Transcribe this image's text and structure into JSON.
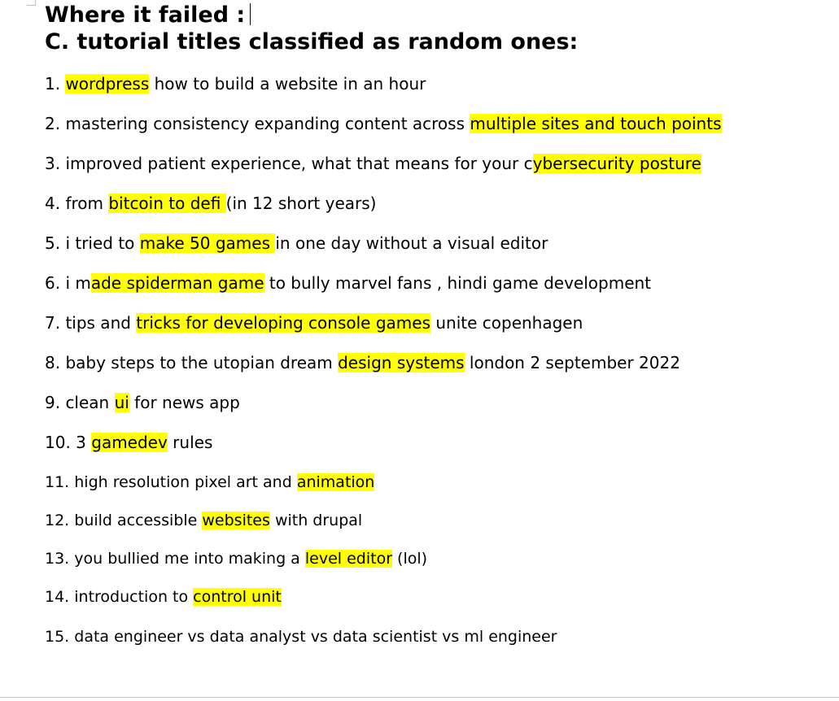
{
  "document": {
    "heading_line1": "Where it failed :",
    "heading_line2": "C. tutorial titles classified as random ones:",
    "highlight_color": "#ffff00",
    "items": [
      {
        "parts": [
          {
            "t": "1. ",
            "h": false
          },
          {
            "t": "wordpress",
            "h": true
          },
          {
            "t": " how to build a website in an hour",
            "h": false
          }
        ]
      },
      {
        "parts": [
          {
            "t": "2. mastering consistency expanding content across ",
            "h": false
          },
          {
            "t": "multiple sites and touch points",
            "h": true
          }
        ]
      },
      {
        "parts": [
          {
            "t": "3. improved patient experience, what that means for your c",
            "h": false
          },
          {
            "t": "ybersecurity posture",
            "h": true
          }
        ]
      },
      {
        "parts": [
          {
            "t": "4. from ",
            "h": false
          },
          {
            "t": "bitcoin to defi ",
            "h": true
          },
          {
            "t": "(in 12 short years)",
            "h": false
          }
        ]
      },
      {
        "parts": [
          {
            "t": "5.  i tried to ",
            "h": false
          },
          {
            "t": "make 50 games ",
            "h": true
          },
          {
            "t": "in one day without a visual editor",
            "h": false
          }
        ]
      },
      {
        "parts": [
          {
            "t": "6. i m",
            "h": false
          },
          {
            "t": "ade spiderman game",
            "h": true
          },
          {
            "t": " to bully marvel fans , hindi game development",
            "h": false
          }
        ]
      },
      {
        "parts": [
          {
            "t": "7.  tips and ",
            "h": false
          },
          {
            "t": "tricks for developing console games",
            "h": true
          },
          {
            "t": " unite copenhagen",
            "h": false
          }
        ]
      },
      {
        "parts": [
          {
            "t": "8. baby steps to the utopian dream ",
            "h": false
          },
          {
            "t": "design systems",
            "h": true
          },
          {
            "t": " london 2 september 2022",
            "h": false
          }
        ]
      },
      {
        "parts": [
          {
            "t": "9. clean ",
            "h": false
          },
          {
            "t": "ui",
            "h": true
          },
          {
            "t": " for news app",
            "h": false
          }
        ]
      },
      {
        "parts": [
          {
            "t": "10. 3 ",
            "h": false
          },
          {
            "t": "gamedev",
            "h": true
          },
          {
            "t": " rules",
            "h": false
          }
        ]
      },
      {
        "parts": [
          {
            "t": "11. high resolution pixel art and ",
            "h": false
          },
          {
            "t": "animation",
            "h": true
          }
        ]
      },
      {
        "parts": [
          {
            "t": "12. build accessible ",
            "h": false
          },
          {
            "t": "websites",
            "h": true
          },
          {
            "t": " with drupal",
            "h": false
          }
        ]
      },
      {
        "parts": [
          {
            "t": "13. you bullied me into making a ",
            "h": false
          },
          {
            "t": "level editor",
            "h": true
          },
          {
            "t": " (lol)",
            "h": false
          }
        ]
      },
      {
        "parts": [
          {
            "t": "14. introduction to ",
            "h": false
          },
          {
            "t": "control unit",
            "h": true
          }
        ]
      },
      {
        "parts": [
          {
            "t": "15. data engineer vs data analyst vs data scientist vs ml engineer",
            "h": false
          }
        ]
      }
    ]
  }
}
